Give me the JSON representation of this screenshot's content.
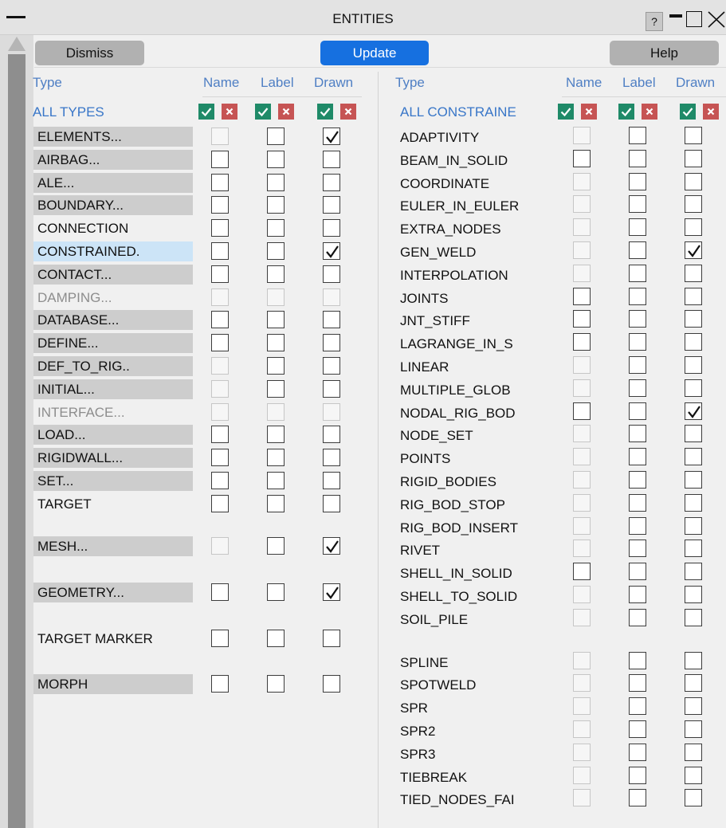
{
  "window": {
    "title": "ENTITIES",
    "help_symbol": "?"
  },
  "buttons": {
    "dismiss": "Dismiss",
    "update": "Update",
    "help": "Help"
  },
  "left": {
    "headers": {
      "type": "Type",
      "name": "Name",
      "label": "Label",
      "drawn": "Drawn"
    },
    "all_label": "ALL TYPES",
    "rows": [
      {
        "label": "ELEMENTS...",
        "style": "gray",
        "name": "disabled",
        "lbl": "off",
        "drawn": "on"
      },
      {
        "label": "AIRBAG...",
        "style": "gray",
        "name": "off",
        "lbl": "off",
        "drawn": "off"
      },
      {
        "label": "ALE...",
        "style": "gray",
        "name": "off",
        "lbl": "off",
        "drawn": "off"
      },
      {
        "label": "BOUNDARY...",
        "style": "gray",
        "name": "off",
        "lbl": "off",
        "drawn": "off"
      },
      {
        "label": "CONNECTION",
        "style": "plain",
        "name": "off",
        "lbl": "off",
        "drawn": "off"
      },
      {
        "label": "CONSTRAINED.",
        "style": "selected",
        "name": "off",
        "lbl": "off",
        "drawn": "on"
      },
      {
        "label": "CONTACT...",
        "style": "gray",
        "name": "off",
        "lbl": "off",
        "drawn": "off"
      },
      {
        "label": "DAMPING...",
        "style": "dim",
        "name": "disabled",
        "lbl": "disabled",
        "drawn": "disabled"
      },
      {
        "label": "DATABASE...",
        "style": "gray",
        "name": "off",
        "lbl": "off",
        "drawn": "off"
      },
      {
        "label": "DEFINE...",
        "style": "gray",
        "name": "off",
        "lbl": "off",
        "drawn": "off"
      },
      {
        "label": "DEF_TO_RIG..",
        "style": "gray",
        "name": "disabled",
        "lbl": "off",
        "drawn": "off"
      },
      {
        "label": "INITIAL...",
        "style": "gray",
        "name": "disabled",
        "lbl": "off",
        "drawn": "off"
      },
      {
        "label": "INTERFACE...",
        "style": "dim",
        "name": "disabled",
        "lbl": "disabled",
        "drawn": "disabled"
      },
      {
        "label": "LOAD...",
        "style": "gray",
        "name": "off",
        "lbl": "off",
        "drawn": "off"
      },
      {
        "label": "RIGIDWALL...",
        "style": "gray",
        "name": "off",
        "lbl": "off",
        "drawn": "off"
      },
      {
        "label": "SET...",
        "style": "gray",
        "name": "off",
        "lbl": "off",
        "drawn": "off"
      },
      {
        "label": "TARGET",
        "style": "plain",
        "name": "off",
        "lbl": "off",
        "drawn": "off"
      }
    ],
    "groups": [
      {
        "label": "MESH...",
        "style": "gray",
        "name": "disabled",
        "lbl": "off",
        "drawn": "on"
      },
      {
        "label": "GEOMETRY...",
        "style": "gray",
        "name": "off",
        "lbl": "off",
        "drawn": "on"
      },
      {
        "label": "TARGET MARKER",
        "style": "plain",
        "name": "off",
        "lbl": "off",
        "drawn": "off"
      },
      {
        "label": "MORPH",
        "style": "gray",
        "name": "off",
        "lbl": "off",
        "drawn": "off"
      }
    ]
  },
  "right": {
    "headers": {
      "type": "Type",
      "name": "Name",
      "label": "Label",
      "drawn": "Drawn"
    },
    "all_label": "ALL CONSTRAINE",
    "rows": [
      {
        "label": "ADAPTIVITY",
        "name": "disabled",
        "lbl": "off",
        "drawn": "off"
      },
      {
        "label": "BEAM_IN_SOLID",
        "name": "off",
        "lbl": "off",
        "drawn": "off"
      },
      {
        "label": "COORDINATE",
        "name": "disabled",
        "lbl": "off",
        "drawn": "off"
      },
      {
        "label": "EULER_IN_EULER",
        "name": "disabled",
        "lbl": "off",
        "drawn": "off"
      },
      {
        "label": "EXTRA_NODES",
        "name": "disabled",
        "lbl": "off",
        "drawn": "off"
      },
      {
        "label": "GEN_WELD",
        "name": "disabled",
        "lbl": "off",
        "drawn": "on"
      },
      {
        "label": "INTERPOLATION",
        "name": "disabled",
        "lbl": "off",
        "drawn": "off"
      },
      {
        "label": "JOINTS",
        "name": "off",
        "lbl": "off",
        "drawn": "off"
      },
      {
        "label": "JNT_STIFF",
        "name": "off",
        "lbl": "off",
        "drawn": "off"
      },
      {
        "label": "LAGRANGE_IN_S",
        "name": "off",
        "lbl": "off",
        "drawn": "off"
      },
      {
        "label": "LINEAR",
        "name": "disabled",
        "lbl": "off",
        "drawn": "off"
      },
      {
        "label": "MULTIPLE_GLOB",
        "name": "disabled",
        "lbl": "off",
        "drawn": "off"
      },
      {
        "label": "NODAL_RIG_BOD",
        "name": "off",
        "lbl": "off",
        "drawn": "on"
      },
      {
        "label": "NODE_SET",
        "name": "disabled",
        "lbl": "off",
        "drawn": "off"
      },
      {
        "label": "POINTS",
        "name": "disabled",
        "lbl": "off",
        "drawn": "off"
      },
      {
        "label": "RIGID_BODIES",
        "name": "disabled",
        "lbl": "off",
        "drawn": "off"
      },
      {
        "label": "RIG_BOD_STOP",
        "name": "disabled",
        "lbl": "off",
        "drawn": "off"
      },
      {
        "label": "RIG_BOD_INSERT",
        "name": "disabled",
        "lbl": "off",
        "drawn": "off"
      },
      {
        "label": "RIVET",
        "name": "disabled",
        "lbl": "off",
        "drawn": "off"
      },
      {
        "label": "SHELL_IN_SOLID",
        "name": "off",
        "lbl": "off",
        "drawn": "off"
      },
      {
        "label": "SHELL_TO_SOLID",
        "name": "disabled",
        "lbl": "off",
        "drawn": "off"
      },
      {
        "label": "SOIL_PILE",
        "name": "disabled",
        "lbl": "off",
        "drawn": "off"
      },
      {
        "label": "SPLINE",
        "name": "disabled",
        "lbl": "off",
        "drawn": "off",
        "gap_before": true
      },
      {
        "label": "SPOTWELD",
        "name": "disabled",
        "lbl": "off",
        "drawn": "off"
      },
      {
        "label": "SPR",
        "name": "disabled",
        "lbl": "off",
        "drawn": "off"
      },
      {
        "label": "SPR2",
        "name": "disabled",
        "lbl": "off",
        "drawn": "off"
      },
      {
        "label": "SPR3",
        "name": "disabled",
        "lbl": "off",
        "drawn": "off"
      },
      {
        "label": "TIEBREAK",
        "name": "disabled",
        "lbl": "off",
        "drawn": "off"
      },
      {
        "label": "TIED_NODES_FAI",
        "name": "disabled",
        "lbl": "off",
        "drawn": "off"
      }
    ]
  }
}
